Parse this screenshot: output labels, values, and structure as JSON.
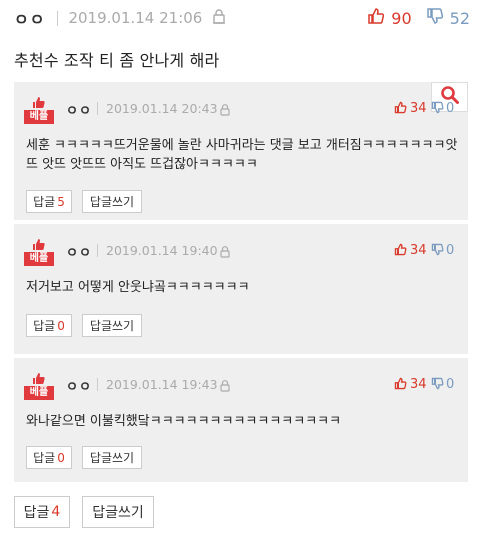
{
  "post": {
    "nick": "ㅇㅇ",
    "date": "2019.01.14 21:06",
    "upvotes": "90",
    "downvotes": "52",
    "text": "추천수 조작 티 좀 안나게 해라"
  },
  "replies": [
    {
      "badge": "베플",
      "nick": "ㅇㅇ",
      "date": "2019.01.14 20:43",
      "upvotes": "34",
      "downvotes": "0",
      "text": "세훈 ㅋㅋㅋㅋㅋ뜨거운물에 놀란 사마귀라는 댓글 보고 개터짐ㅋㅋㅋㅋㅋㅋㅋ앗뜨 앗뜨 앗뜨뜨 아직도 뜨겁잖아ㅋㅋㅋㅋㅋ",
      "reply_label": "답글",
      "reply_count": "5",
      "write_label": "답글쓰기"
    },
    {
      "badge": "베플",
      "nick": "ㅇㅇ",
      "date": "2019.01.14 19:40",
      "upvotes": "34",
      "downvotes": "0",
      "text": "저거보고 어떻게 안웃냐곸ㅋㅋㅋㅋㅋㅋㅋ",
      "reply_label": "답글",
      "reply_count": "0",
      "write_label": "답글쓰기"
    },
    {
      "badge": "베플",
      "nick": "ㅇㅇ",
      "date": "2019.01.14 19:43",
      "upvotes": "34",
      "downvotes": "0",
      "text": "와나같으면 이불킥했닼ㅋㅋㅋㅋㅋㅋㅋㅋㅋㅋㅋㅋㅋㅋㅋㅋ",
      "reply_label": "답글",
      "reply_count": "0",
      "write_label": "답글쓰기"
    }
  ],
  "footer": {
    "reply_label": "답글",
    "reply_count": "4",
    "write_label": "답글쓰기"
  },
  "icons": {
    "search": "search-icon",
    "thumbs_up": "thumbs-up-icon",
    "thumbs_down": "thumbs-down-icon",
    "lock": "lock-icon"
  },
  "colors": {
    "accent_red": "#d93a2b",
    "down_blue": "#7a9bbf",
    "badge_red": "#e0393e",
    "reply_bg": "#efefef"
  }
}
